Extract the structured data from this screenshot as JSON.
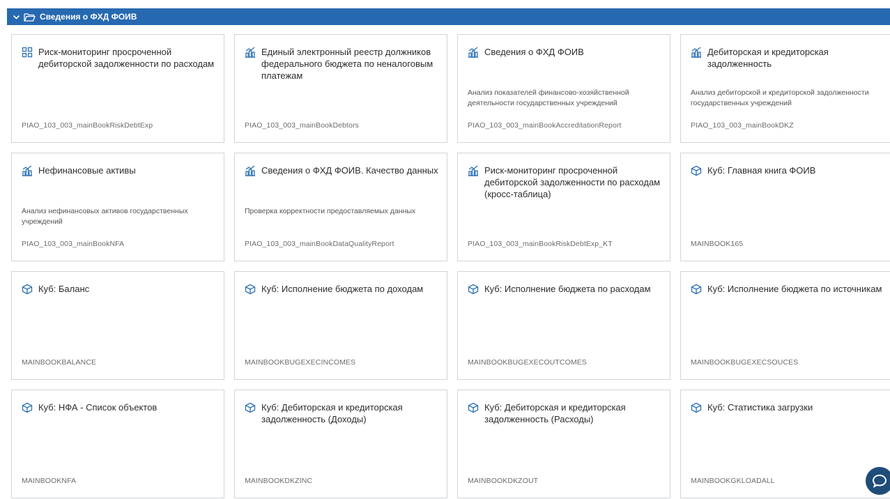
{
  "header": {
    "title": "Сведения о ФХД ФОИВ"
  },
  "colors": {
    "accent": "#2769b0",
    "icon": "#2a6fb4"
  },
  "cards": [
    {
      "icon": "grid-icon",
      "title": "Риск-мониторинг просроченной дебиторской задолженности по расходам",
      "desc": "",
      "code": "PIAO_103_003_mainBookRiskDebtExp"
    },
    {
      "icon": "chart-icon",
      "title": "Единый электронный реестр должников федерального бюджета по неналоговым платежам",
      "desc": "",
      "code": "PIAO_103_003_mainBookDebtors"
    },
    {
      "icon": "chart-icon",
      "title": "Сведения о ФХД ФОИВ",
      "desc": "Анализ показателей финансово-хозяйственной деятельности государственных учреждений",
      "code": "PIAO_103_003_mainBookAccreditationReport"
    },
    {
      "icon": "chart-icon",
      "title": "Дебиторская и кредиторская задолженность",
      "desc": "Анализ дебиторской и кредиторской задолженности государственных учреждений",
      "code": "PIAO_103_003_mainBookDKZ"
    },
    {
      "icon": "chart-icon",
      "title": "Нефинансовые активы",
      "desc": "Анализ нефинансовых активов государственных учреждений",
      "code": "PIAO_103_003_mainBookNFA"
    },
    {
      "icon": "chart-icon",
      "title": "Сведения о ФХД ФОИВ. Качество данных",
      "desc": "Проверка корректности предоставляемых данных",
      "code": "PIAO_103_003_mainBookDataQualityReport"
    },
    {
      "icon": "chart-icon",
      "title": "Риск-мониторинг просроченной дебиторской задолженности по расходам (кросс-таблица)",
      "desc": "",
      "code": "PIAO_103_003_mainBookRiskDebtExp_KT"
    },
    {
      "icon": "cube-icon",
      "title": "Куб: Главная книга ФОИВ",
      "desc": "",
      "code": "MAINBOOK165"
    },
    {
      "icon": "cube-icon",
      "title": "Куб: Баланс",
      "desc": "",
      "code": "MAINBOOKBALANCE"
    },
    {
      "icon": "cube-icon",
      "title": "Куб: Исполнение бюджета по доходам",
      "desc": "",
      "code": "MAINBOOKBUGEXECINCOMES"
    },
    {
      "icon": "cube-icon",
      "title": "Куб: Исполнение бюджета по расходам",
      "desc": "",
      "code": "MAINBOOKBUGEXECOUTCOMES"
    },
    {
      "icon": "cube-icon",
      "title": "Куб: Исполнение бюджета по источникам",
      "desc": "",
      "code": "MAINBOOKBUGEXECSOUCES"
    },
    {
      "icon": "cube-icon",
      "title": "Куб: НФА - Список объектов",
      "desc": "",
      "code": "MAINBOOKNFA"
    },
    {
      "icon": "cube-icon",
      "title": "Куб: Дебиторская и кредиторская задолженность (Доходы)",
      "desc": "",
      "code": "MAINBOOKDKZINC"
    },
    {
      "icon": "cube-icon",
      "title": "Куб: Дебиторская и кредиторская задолженность (Расходы)",
      "desc": "",
      "code": "MAINBOOKDKZOUT"
    },
    {
      "icon": "cube-icon",
      "title": "Куб: Статистика загрузки",
      "desc": "",
      "code": "MAINBOOKGKLOADALL"
    }
  ]
}
